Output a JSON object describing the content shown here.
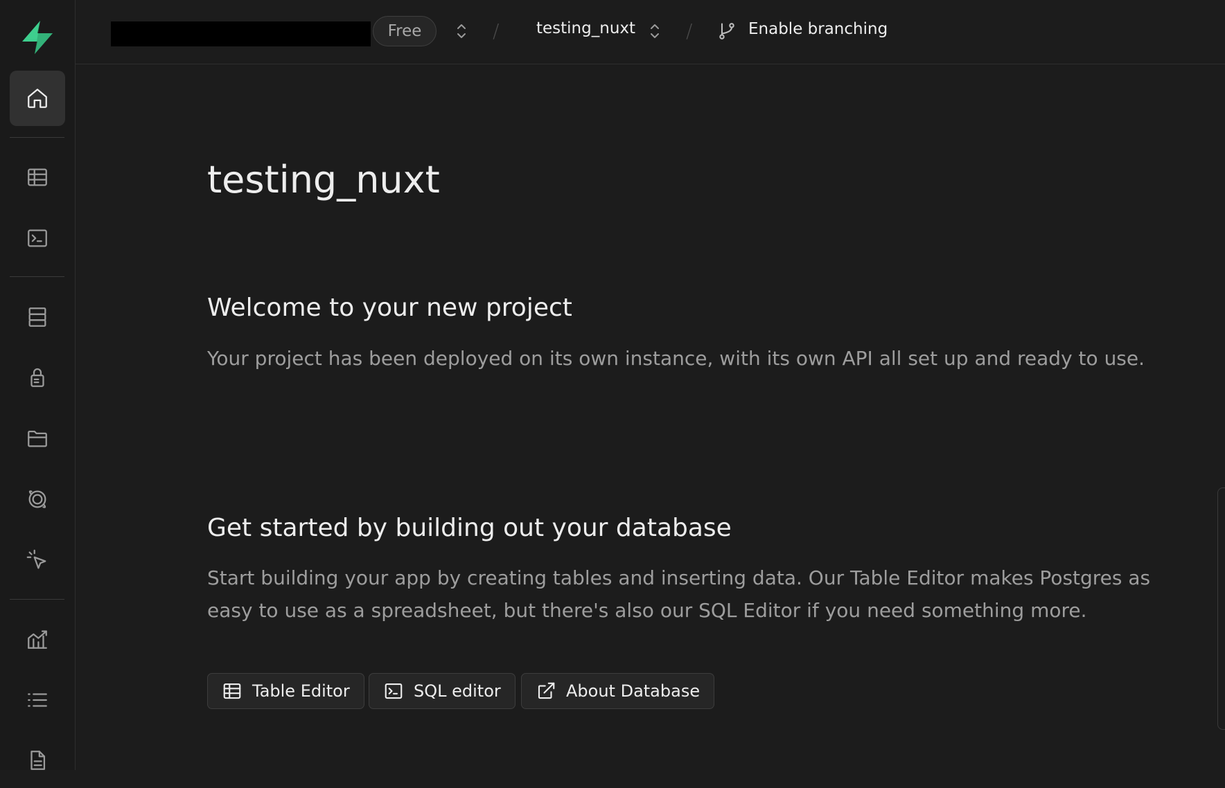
{
  "topbar": {
    "plan_label": "Free",
    "project_name": "testing_nuxt",
    "branching_label": "Enable branching",
    "separator": "/"
  },
  "sidebar": {
    "items": [
      {
        "name": "home",
        "icon": "home-icon",
        "active": true
      },
      {
        "name": "table-editor",
        "icon": "table-icon"
      },
      {
        "name": "sql-editor",
        "icon": "terminal-icon"
      },
      {
        "name": "database",
        "icon": "database-icon"
      },
      {
        "name": "authentication",
        "icon": "lock-icon"
      },
      {
        "name": "storage",
        "icon": "folder-icon"
      },
      {
        "name": "realtime",
        "icon": "realtime-icon"
      },
      {
        "name": "edge-functions",
        "icon": "cursor-icon"
      },
      {
        "name": "reports",
        "icon": "chart-icon"
      },
      {
        "name": "logs",
        "icon": "list-icon"
      },
      {
        "name": "api-docs",
        "icon": "document-icon"
      }
    ]
  },
  "main": {
    "title": "testing_nuxt",
    "welcome": {
      "heading": "Welcome to your new project",
      "text": "Your project has been deployed on its own instance, with its own API all set up and ready to use."
    },
    "database": {
      "heading": "Get started by building out your database",
      "text": "Start building your app by creating tables and inserting data. Our Table Editor makes Postgres as easy to use as a spreadsheet, but there's also our SQL Editor if you need something more."
    },
    "buttons": {
      "table_editor": "Table Editor",
      "sql_editor": "SQL editor",
      "about_database": "About Database"
    }
  },
  "colors": {
    "background": "#1c1c1c",
    "sidebar": "#1a1a1a",
    "brand_green": "#3ecf8e",
    "text_primary": "#ededed",
    "text_muted": "#9d9d9d"
  }
}
